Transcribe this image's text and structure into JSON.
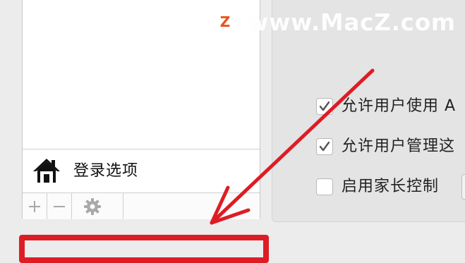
{
  "users_panel": {
    "login_options_label": "登录选项",
    "icons": {
      "login": "house-icon",
      "add": "plus-icon",
      "remove": "minus-icon",
      "action": "gear-icon"
    }
  },
  "settings": {
    "options": [
      {
        "label": "允许用户使用 A",
        "checked": true
      },
      {
        "label": "允许用户管理这",
        "checked": true
      },
      {
        "label": "启用家长控制",
        "checked": false
      }
    ]
  },
  "watermark": {
    "logo": "Z",
    "text": "www.MacZ.com"
  },
  "annotation": {
    "color": "#de1c24"
  }
}
